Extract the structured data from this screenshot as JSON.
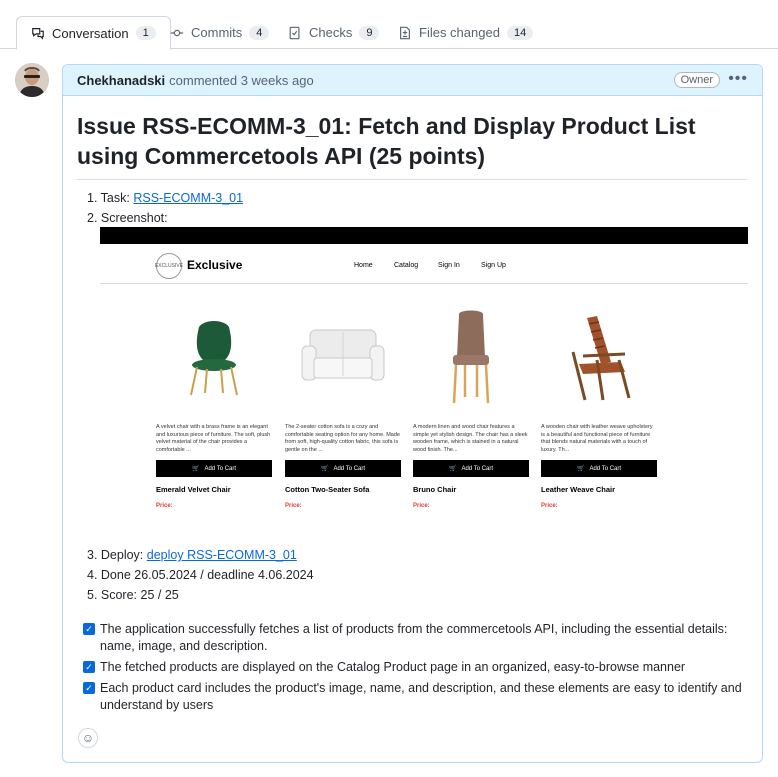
{
  "tabs": [
    {
      "label": "Conversation",
      "count": "1",
      "icon": "comment-discussion-icon"
    },
    {
      "label": "Commits",
      "count": "4",
      "icon": "commit-icon"
    },
    {
      "label": "Checks",
      "count": "9",
      "icon": "checklist-icon"
    },
    {
      "label": "Files changed",
      "count": "14",
      "icon": "file-diff-icon"
    }
  ],
  "comment": {
    "author": "Chekhanadski",
    "meta": "commented 3 weeks ago",
    "badge": "Owner",
    "menu": "•••",
    "title": "Issue RSS-ECOMM-3_01: Fetch and Display Product List using Commercetools API (25 points)",
    "items": {
      "task_prefix": "1. Task: ",
      "task_link": "RSS-ECOMM-3_01",
      "screenshot_label": "2. Screenshot:",
      "deploy_prefix": "3. Deploy: ",
      "deploy_link": "deploy RSS-ECOMM-3_01",
      "done": "4. Done 26.05.2024 / deadline 4.06.2024",
      "score": "5. Score: 25 / 25"
    },
    "tasks": [
      "The application successfully fetches a list of products from the commercetools API, including the essential details: name, image, and description.",
      "The fetched products are displayed on the Catalog Product page in an organized, easy-to-browse manner",
      "Each product card includes the product's image, name, and description, and these elements are easy to identify and understand by users"
    ]
  },
  "screenshot": {
    "logo_text": "EXCLUSIVE",
    "brand": "Exclusive",
    "nav": [
      "Home",
      "Catalog",
      "Sign In",
      "Sign Up"
    ],
    "cart_label": "Add To Cart",
    "price_label": "Price:",
    "products": [
      {
        "name": "Emerald Velvet Chair",
        "desc": "A velvet chair with a brass frame is an elegant and luxurious piece of furniture. The soft, plush velvet material of the chair provides a comfortable ..."
      },
      {
        "name": "Cotton Two-Seater Sofa",
        "desc": "The 2-seater cotton sofa is a cozy and comfortable seating option for any home. Made from soft, high-quality cotton fabric, this sofa is gentle on the ..."
      },
      {
        "name": "Bruno Chair",
        "desc": "A modern linen and wood chair features a simple yet stylish design. The chair has a sleek wooden frame, which is stained in a natural wood finish. The..."
      },
      {
        "name": "Leather Weave Chair",
        "desc": "A wooden chair with leather weave upholstery is a beautiful and functional piece of furniture that blends natural materials with a touch of luxury. Th..."
      }
    ]
  },
  "colors": {
    "accent": "#0969da",
    "header_bg": "#ddf4ff",
    "price": "#e03b3b"
  }
}
